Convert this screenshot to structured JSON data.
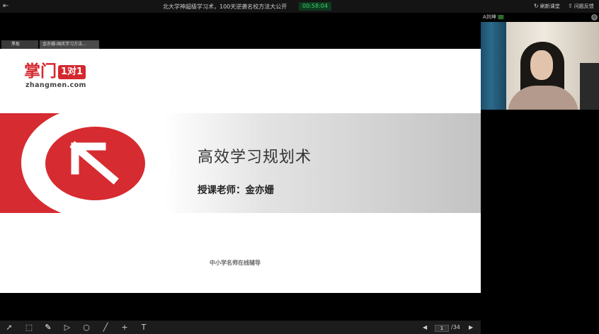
{
  "topbar": {
    "title": "北大学神超级学习术，100天逆袭名校方法大公开",
    "timer": "00:58:04",
    "refresh_label": "刷新课堂",
    "feedback_label": "问题反馈"
  },
  "tabs": [
    {
      "label": "黑板"
    },
    {
      "label": "金亦姗-国庆学习方法..."
    }
  ],
  "slide": {
    "logo_text": "掌门",
    "logo_badge": "1对1",
    "logo_url": "zhangmen.com",
    "title": "高效学习规划术",
    "subtitle": "授课老师：金亦姗",
    "footer": "中小学名师在线辅导",
    "brand_color": "#d62b30"
  },
  "camera": {
    "name": "A刘坤",
    "signal": "||||||||"
  },
  "toolbar": {
    "tools": [
      "pointer-icon",
      "select-icon",
      "pen-icon",
      "triangle-icon",
      "circle-icon",
      "line-icon",
      "cross-icon",
      "text-icon"
    ],
    "page_current": "1",
    "page_total": "/34"
  }
}
